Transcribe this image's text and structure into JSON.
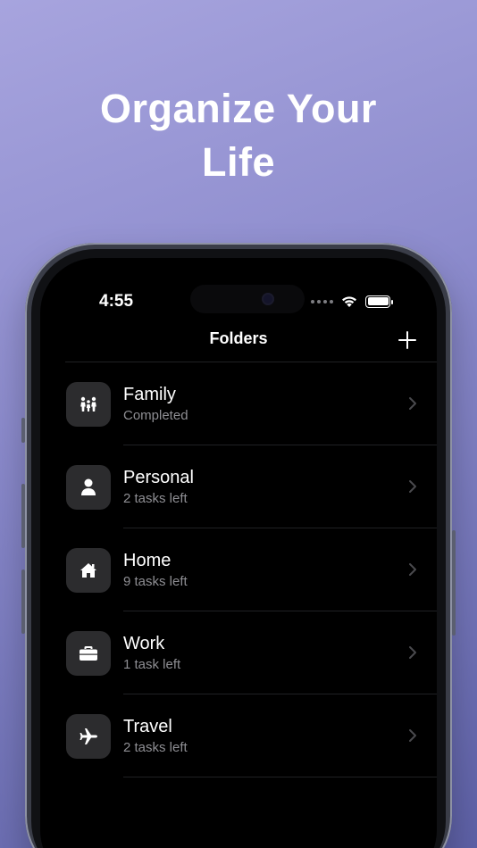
{
  "headline": {
    "line1": "Organize Your",
    "line2": "Life"
  },
  "status_bar": {
    "time": "4:55"
  },
  "nav": {
    "title": "Folders"
  },
  "folders": [
    {
      "title": "Family",
      "subtitle": "Completed",
      "icon": "family-icon"
    },
    {
      "title": "Personal",
      "subtitle": "2 tasks left",
      "icon": "person-icon"
    },
    {
      "title": "Home",
      "subtitle": "9 tasks left",
      "icon": "house-icon"
    },
    {
      "title": "Work",
      "subtitle": "1 task left",
      "icon": "briefcase-icon"
    },
    {
      "title": "Travel",
      "subtitle": "2 tasks left",
      "icon": "airplane-icon"
    }
  ],
  "colors": {
    "background_gradient": [
      "#a7a4de",
      "#5d60a6"
    ],
    "screen": "#000000",
    "icon_tile": "#2c2c2e",
    "secondary_text": "#8e8e93"
  }
}
